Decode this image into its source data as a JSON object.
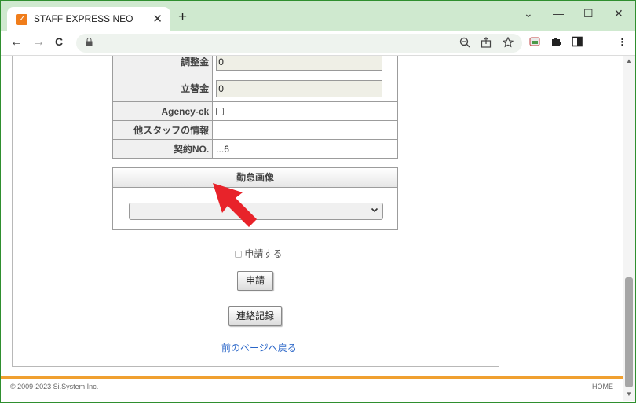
{
  "browser": {
    "tab_title": "STAFF EXPRESS NEO",
    "tab_close": "✕",
    "new_tab": "+",
    "window_controls": {
      "minimize": "—",
      "maximize": "☐",
      "close": "✕",
      "tab_search": "⌄"
    },
    "nav": {
      "back": "←",
      "forward": "→",
      "reload": "C"
    },
    "address_icons": [
      "zoom-icon",
      "share-icon",
      "bookmark-star-icon"
    ],
    "toolbar_icons": [
      "extension-icon",
      "puzzle-icon",
      "side-panel-icon",
      "menu-icon"
    ],
    "accent_color": "#cfe9cf"
  },
  "form": {
    "rows": [
      {
        "label": "調整金",
        "value": "0",
        "type": "text"
      },
      {
        "label": "立替金",
        "value": "0",
        "type": "text"
      },
      {
        "label": "Agency-ck",
        "type": "checkbox",
        "checked": false
      },
      {
        "label": "他スタッフの情報",
        "value": "",
        "type": "static"
      },
      {
        "label": "契約NO.",
        "value": "...6",
        "type": "static"
      }
    ]
  },
  "image_section": {
    "header": "勤怠画像",
    "select_value": ""
  },
  "actions": {
    "apply_check_label": "申請する",
    "apply_button": "申請",
    "contact_button": "連絡記録",
    "back_link": "前のページへ戻る"
  },
  "footer": {
    "copyright": "© 2009-2023 Si.System Inc.",
    "home": "HOME",
    "accent_color": "#f0a030"
  },
  "annotation": {
    "arrow_color": "#e8232a"
  }
}
